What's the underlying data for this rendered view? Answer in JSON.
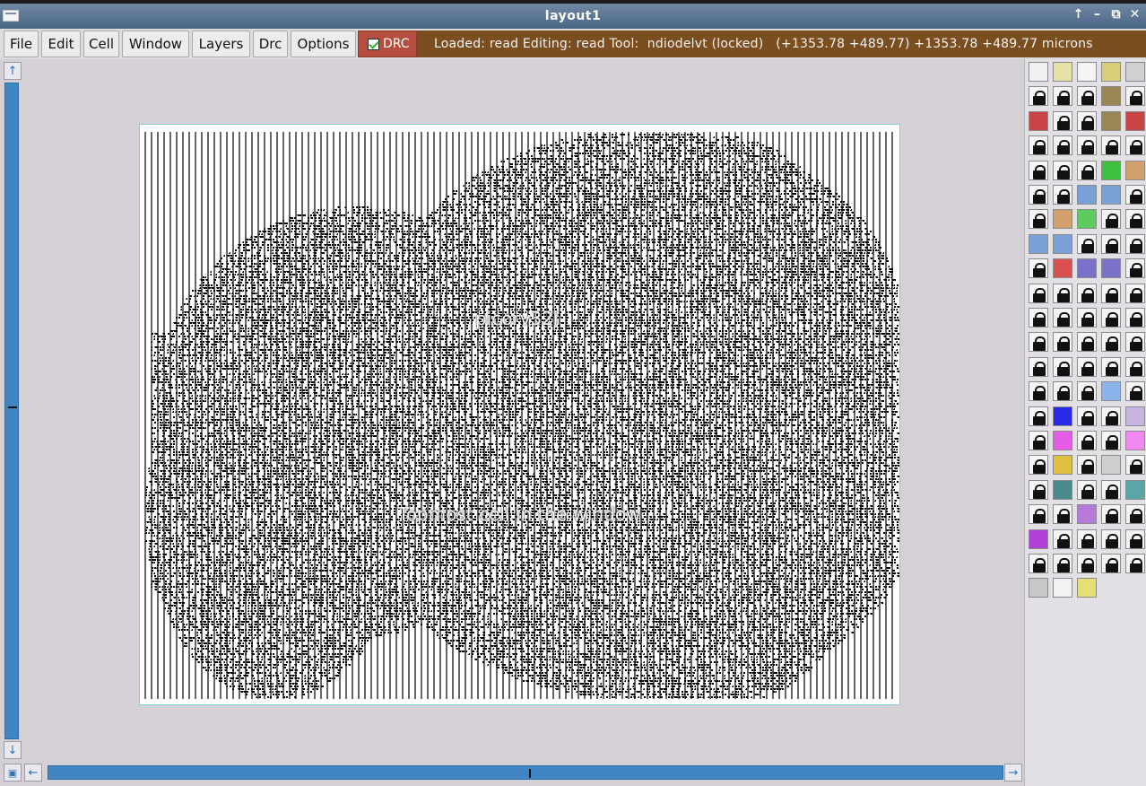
{
  "window": {
    "title": "layout1",
    "controls": [
      "↑",
      "–",
      "⧉",
      "✕"
    ]
  },
  "menu": {
    "items": [
      "File",
      "Edit",
      "Cell",
      "Window",
      "Layers",
      "Drc",
      "Options"
    ],
    "drc_toggle": {
      "label": "DRC",
      "checked": true
    }
  },
  "status": {
    "text": "Loaded: read Editing: read Tool:  ndiodelvt (locked)   (+1353.78 +489.77) +1353.78 +489.77 microns"
  },
  "layout": {
    "cell_name": "picorv32i",
    "note": "Topmost cell in the window"
  },
  "scrollbars": {
    "up": "↑",
    "down": "↓",
    "left": "←",
    "right": "→",
    "corner": "▣"
  },
  "palette": {
    "rows": [
      [
        "#f0f0f0",
        "#e7e2a8",
        "#f4f4f4",
        "#d8cf78",
        "#d0d0d0"
      ],
      [
        "lock",
        "lock",
        "lock",
        "#9a8652",
        "lock"
      ],
      [
        "#c94444",
        "lock",
        "lock",
        "#9a8652",
        "#c94444"
      ],
      [
        "lock",
        "lock",
        "lock",
        "lock",
        "lock"
      ],
      [
        "lock",
        "lock",
        "lock",
        "#3ec13e",
        "#d2a06c"
      ],
      [
        "lock",
        "lock",
        "#7aa0d8",
        "#7aa0d8",
        "lock"
      ],
      [
        "lock",
        "#d2a06c",
        "#5ecb5e",
        "lock",
        "lock"
      ],
      [
        "#7aa0d8",
        "#7aa0d8",
        "lock",
        "lock",
        "lock"
      ],
      [
        "lock",
        "#d85050",
        "#7a72c8",
        "#7a72c8",
        "lock"
      ],
      [
        "lock",
        "lock",
        "lock",
        "lock",
        "lock"
      ],
      [
        "lock",
        "lock",
        "lock",
        "lock",
        "lock"
      ],
      [
        "lock",
        "lock",
        "lock",
        "lock",
        "lock"
      ],
      [
        "lock",
        "lock",
        "lock",
        "lock",
        "lock"
      ],
      [
        "lock",
        "lock",
        "lock",
        "#8ab4ee",
        "lock"
      ],
      [
        "lock",
        "#2a2ae8",
        "lock",
        "lock",
        "#c5b5e0"
      ],
      [
        "lock",
        "#e65ce6",
        "lock",
        "lock",
        "#f08af0"
      ],
      [
        "lock",
        "#e0c040",
        "lock",
        "#cfcfcf",
        "lock"
      ],
      [
        "lock",
        "#4a8a8a",
        "lock",
        "lock",
        "#5aa6a6"
      ],
      [
        "lock",
        "lock",
        "#b87ad8",
        "lock",
        "lock"
      ],
      [
        "#b040d8",
        "lock",
        "lock",
        "lock",
        "lock"
      ],
      [
        "lock",
        "lock",
        "lock",
        "lock",
        "lock"
      ],
      [
        "#c8c8c8",
        "#f2f2f2",
        "#e6e074"
      ]
    ]
  }
}
